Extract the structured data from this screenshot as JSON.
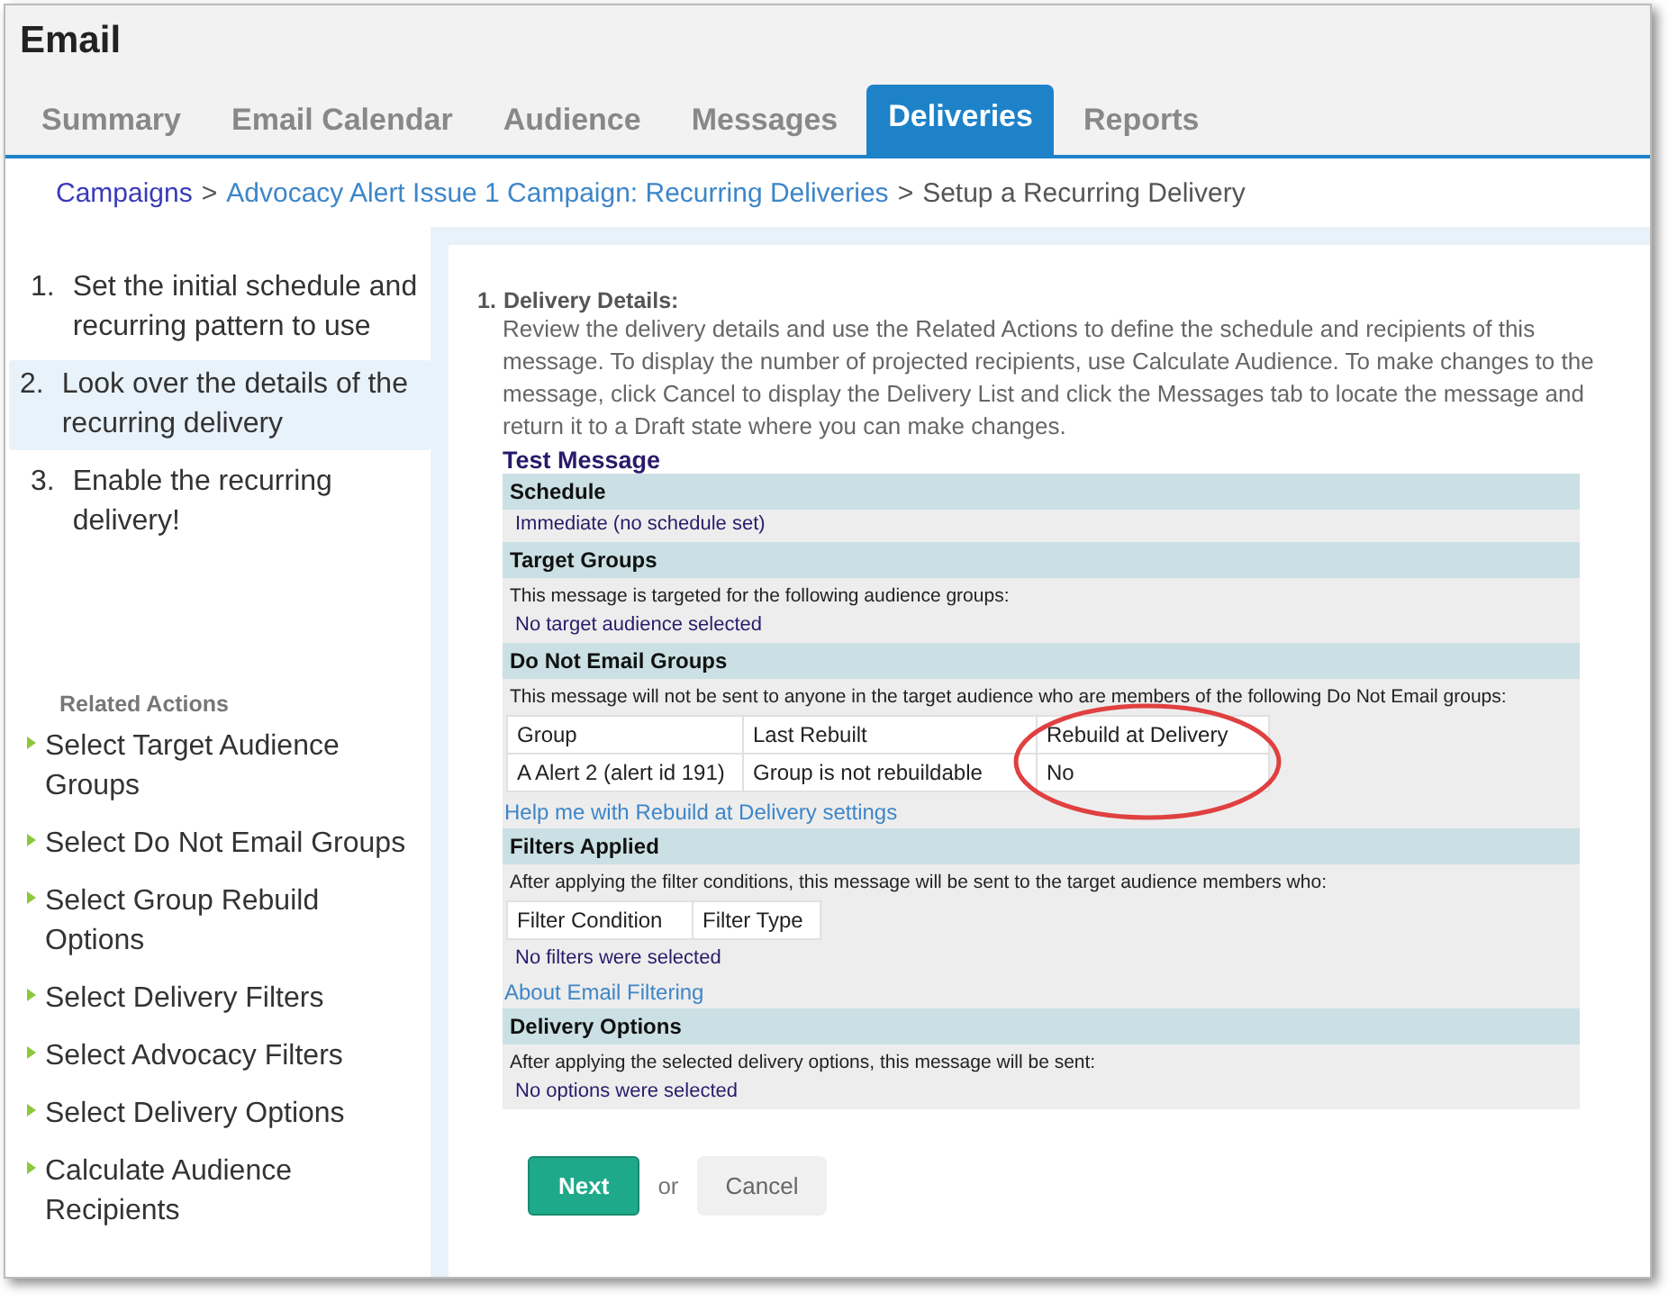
{
  "window": {
    "title": "Email"
  },
  "tabs": [
    {
      "label": "Summary",
      "selected": false
    },
    {
      "label": "Email Calendar",
      "selected": false
    },
    {
      "label": "Audience",
      "selected": false
    },
    {
      "label": "Messages",
      "selected": false
    },
    {
      "label": "Deliveries",
      "selected": true
    },
    {
      "label": "Reports",
      "selected": false
    }
  ],
  "breadcrumb": [
    {
      "label": "Campaigns",
      "kind": "visited",
      "separator": ">"
    },
    {
      "label": "Advocacy Alert Issue 1 Campaign: Recurring Deliveries",
      "kind": "link",
      "separator": ">"
    },
    {
      "label": "Setup a Recurring Delivery",
      "kind": "current"
    }
  ],
  "steps": [
    {
      "number": "1.",
      "label": "Set the initial schedule and recurring pattern to use",
      "selected": false
    },
    {
      "number": "2.",
      "label": "Look over the details of the recurring delivery",
      "selected": true
    },
    {
      "number": "3.",
      "label": "Enable the recurring delivery!",
      "selected": false
    }
  ],
  "related_actions": {
    "title": "Related Actions",
    "items": [
      "Select Target Audience Groups",
      "Select Do Not Email Groups",
      "Select Group Rebuild Options",
      "Select Delivery Filters",
      "Select Advocacy Filters",
      "Select Delivery Options",
      "Calculate Audience Recipients"
    ]
  },
  "details": {
    "number": "1.",
    "title": "Delivery Details:",
    "description": "Review the delivery details and use the Related Actions to define the schedule and recipients of this message. To display the number of projected recipients, use Calculate Audience. To make changes to the message, click Cancel to display the Delivery List and click the Messages tab to locate the message and return it to a Draft state where you can make changes.",
    "message_name": "Test Message",
    "sections": [
      {
        "title": "Schedule",
        "rows": [
          {
            "kind": "value",
            "text": "Immediate (no schedule set)"
          }
        ]
      },
      {
        "title": "Target Groups",
        "rows": [
          {
            "kind": "note",
            "text": "This message is targeted for the following audience groups:"
          },
          {
            "kind": "value",
            "text": "No target audience selected"
          }
        ]
      },
      {
        "title": "Do Not Email Groups",
        "rows": [
          {
            "kind": "note",
            "text": "This message will not be sent to anyone in the target audience who are members of the following Do Not Email groups:"
          },
          {
            "kind": "table",
            "columns": [
              "Group",
              "Last Rebuilt",
              "Rebuild at Delivery"
            ],
            "rows": [
              [
                "A Alert 2 (alert id 191)",
                "Group is not rebuildable",
                "No"
              ]
            ],
            "last_column_circled": true
          },
          {
            "kind": "link",
            "text": "Help me with Rebuild at Delivery settings"
          }
        ]
      },
      {
        "title": "Filters Applied",
        "rows": [
          {
            "kind": "note",
            "text": "After applying the filter conditions, this message will be sent to the target audience members who:"
          },
          {
            "kind": "table",
            "columns": [
              "Filter Condition",
              "Filter Type"
            ],
            "rows": []
          },
          {
            "kind": "value",
            "text": "No filters were selected"
          },
          {
            "kind": "link",
            "text": "About Email Filtering"
          }
        ]
      },
      {
        "title": "Delivery Options",
        "rows": [
          {
            "kind": "note",
            "text": "After applying the selected delivery options, this message will be sent:"
          },
          {
            "kind": "value",
            "text": "No options were selected"
          }
        ]
      }
    ]
  },
  "buttons": {
    "next": "Next",
    "separator": "or",
    "cancel": "Cancel"
  }
}
